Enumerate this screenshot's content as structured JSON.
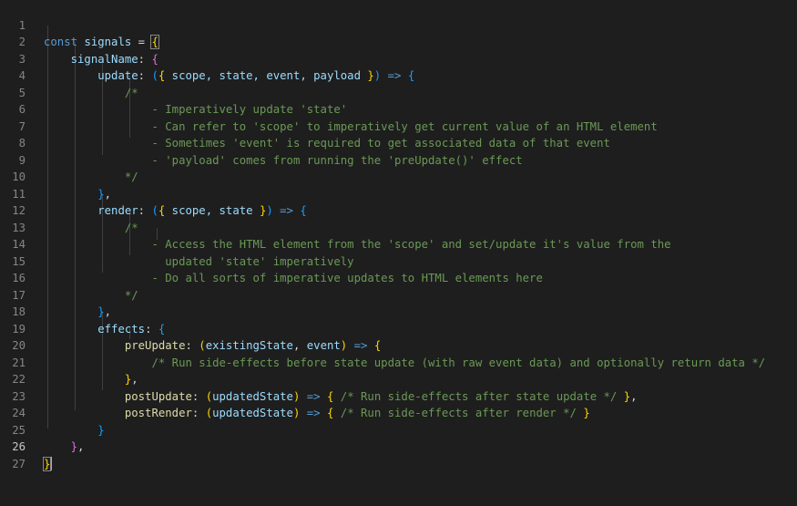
{
  "editor": {
    "line_numbers": [
      "1",
      "2",
      "3",
      "4",
      "5",
      "6",
      "7",
      "8",
      "9",
      "10",
      "11",
      "12",
      "13",
      "14",
      "15",
      "16",
      "17",
      "18",
      "19",
      "20",
      "21",
      "22",
      "23",
      "24",
      "25",
      "26",
      "27"
    ],
    "active_line": "26"
  },
  "code": {
    "l1": {
      "t1": "const",
      "t2": " ",
      "t3": "signals",
      "t4": " = ",
      "t5": "{"
    },
    "l2": {
      "t1": "signalName",
      "t2": ": ",
      "t3": "{"
    },
    "l3": {
      "t1": "update",
      "t2": ": ",
      "t3": "(",
      "t4": "{",
      "t5": " scope, state, event, payload ",
      "t6": "}",
      "t7": ")",
      "t8": " => ",
      "t9": "{"
    },
    "l4": {
      "t1": "/*"
    },
    "l5": {
      "t1": "- Imperatively update 'state'"
    },
    "l6": {
      "t1": "- Can refer to 'scope' to imperatively get current value of an HTML element"
    },
    "l7": {
      "t1": "- Sometimes 'event' is required to get associated data of that event"
    },
    "l8": {
      "t1": "- 'payload' comes from running the 'preUpdate()' effect"
    },
    "l9": {
      "t1": "*/"
    },
    "l10": {
      "t1": "}",
      "t2": ","
    },
    "l11": {
      "t1": "render",
      "t2": ": ",
      "t3": "(",
      "t4": "{",
      "t5": " scope, state ",
      "t6": "}",
      "t7": ")",
      "t8": " => ",
      "t9": "{"
    },
    "l12": {
      "t1": "/*"
    },
    "l13": {
      "t1": "- Access the HTML element from the 'scope' and set/update it's value from the"
    },
    "l14": {
      "t1": "updated 'state' imperatively"
    },
    "l15": {
      "t1": "- Do all sorts of imperative updates to HTML elements here"
    },
    "l16": {
      "t1": "*/"
    },
    "l17": {
      "t1": "}",
      "t2": ","
    },
    "l18": {
      "t1": "effects",
      "t2": ": ",
      "t3": "{"
    },
    "l19": {
      "t1": "preUpdate",
      "t2": ": ",
      "t3": "(",
      "t4": "existingState",
      "t5": ", ",
      "t6": "event",
      "t7": ")",
      "t8": " => ",
      "t9": "{"
    },
    "l20": {
      "t1": "/* Run side-effects before state update (with raw event data) and optionally return data */"
    },
    "l21": {
      "t1": "}",
      "t2": ","
    },
    "l22": {
      "t1": "postUpdate",
      "t2": ": ",
      "t3": "(",
      "t4": "updatedState",
      "t5": ")",
      "t6": " => ",
      "t7": "{",
      "t8": " ",
      "t9": "/* Run side-effects after state update */",
      "t10": " ",
      "t11": "}",
      "t12": ","
    },
    "l23": {
      "t1": "postRender",
      "t2": ": ",
      "t3": "(",
      "t4": "updatedState",
      "t5": ")",
      "t6": " => ",
      "t7": "{",
      "t8": " ",
      "t9": "/* Run side-effects after render */",
      "t10": " ",
      "t11": "}"
    },
    "l24": {
      "t1": "}"
    },
    "l25": {
      "t1": "}",
      "t2": ","
    },
    "l26": {
      "t1": "}"
    }
  }
}
